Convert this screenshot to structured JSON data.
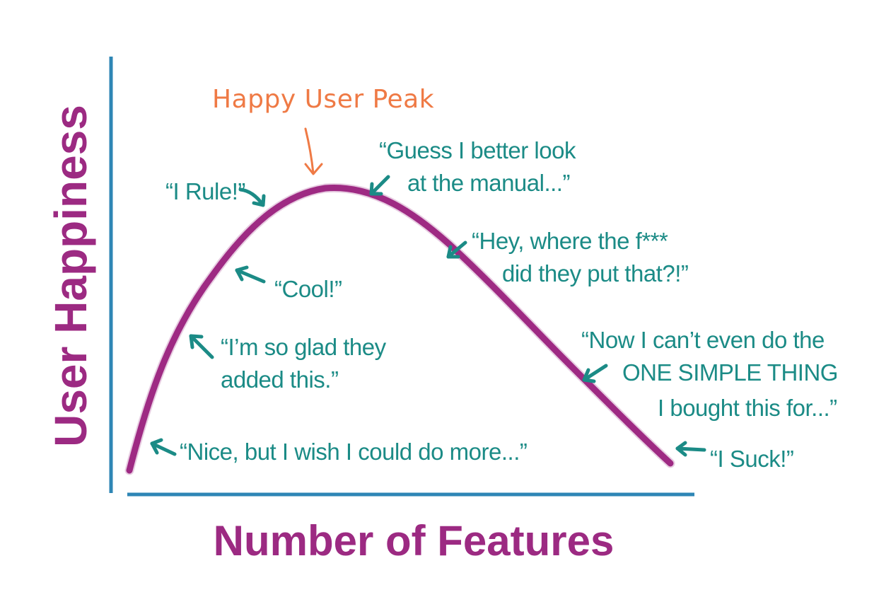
{
  "axes": {
    "y_title": "User Happiness",
    "x_title": "Number of Features"
  },
  "peak": {
    "label": "Happy User Peak"
  },
  "quotes": {
    "nice": "“Nice, but I wish I could do more...”",
    "glad_line1": "“I’m so glad they",
    "glad_line2": "added this.”",
    "cool": "“Cool!”",
    "rule": "“I Rule!”",
    "manual_line1": "“Guess I better look",
    "manual_line2": "at the manual...”",
    "where_line1": "“Hey, where the f***",
    "where_line2": "did they put that?!”",
    "cant_line1": "“Now I can’t even do the",
    "cant_line2": "ONE SIMPLE THING",
    "cant_line3": "I bought this for...”",
    "suck": "“I Suck!”"
  },
  "colors": {
    "curve": "#9e2a83",
    "axes": "#2e86b5",
    "quotes": "#1b8b86",
    "peak_label": "#ef7a45",
    "axis_titles": "#9c2a82"
  }
}
